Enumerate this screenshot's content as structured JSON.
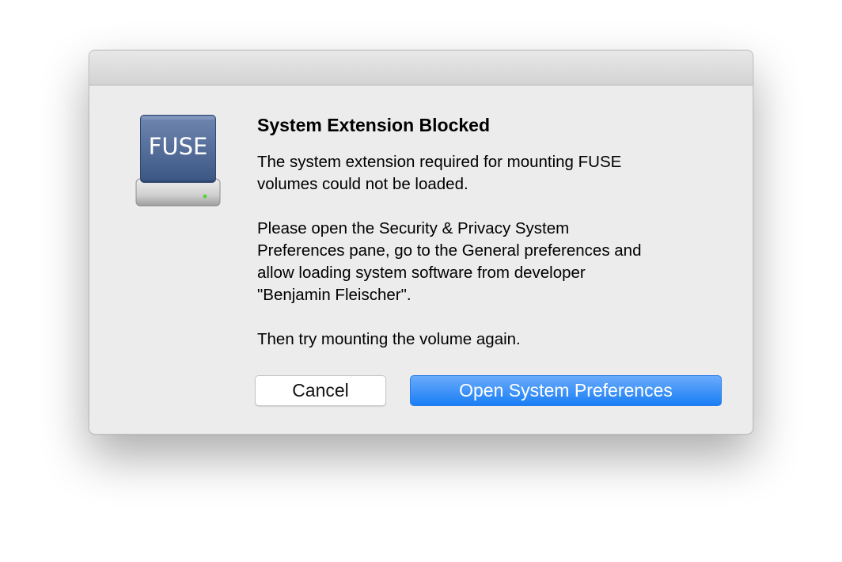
{
  "dialog": {
    "title": "System Extension Blocked",
    "message_lines_1": "The system extension required for mounting FUSE\nvolumes could not be loaded.",
    "message_lines_2": "Please open the Security & Privacy System\nPreferences pane, go to the General preferences and\nallow loading system software from developer\n\"Benjamin Fleischer\".",
    "message_lines_3": "Then try mounting the volume again.",
    "icon": {
      "name": "fuse-drive-icon",
      "label": "FUSE"
    },
    "buttons": {
      "cancel_label": "Cancel",
      "primary_label": "Open System Preferences"
    }
  },
  "colors": {
    "accent": "#1a7ef5",
    "dialog_background": "#ececec"
  }
}
